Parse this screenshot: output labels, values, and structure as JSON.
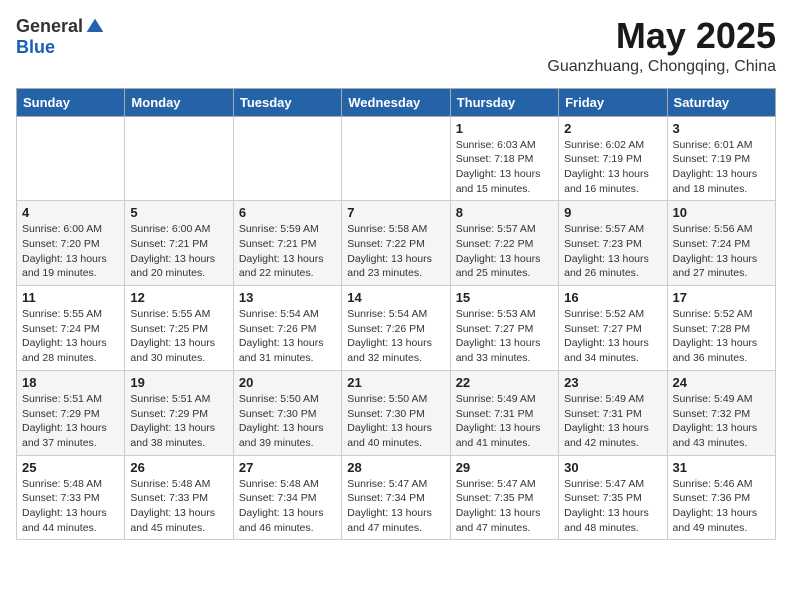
{
  "logo": {
    "general": "General",
    "blue": "Blue"
  },
  "title": "May 2025",
  "location": "Guanzhuang, Chongqing, China",
  "weekdays": [
    "Sunday",
    "Monday",
    "Tuesday",
    "Wednesday",
    "Thursday",
    "Friday",
    "Saturday"
  ],
  "rows": [
    [
      {
        "day": "",
        "info": ""
      },
      {
        "day": "",
        "info": ""
      },
      {
        "day": "",
        "info": ""
      },
      {
        "day": "",
        "info": ""
      },
      {
        "day": "1",
        "info": "Sunrise: 6:03 AM\nSunset: 7:18 PM\nDaylight: 13 hours\nand 15 minutes."
      },
      {
        "day": "2",
        "info": "Sunrise: 6:02 AM\nSunset: 7:19 PM\nDaylight: 13 hours\nand 16 minutes."
      },
      {
        "day": "3",
        "info": "Sunrise: 6:01 AM\nSunset: 7:19 PM\nDaylight: 13 hours\nand 18 minutes."
      }
    ],
    [
      {
        "day": "4",
        "info": "Sunrise: 6:00 AM\nSunset: 7:20 PM\nDaylight: 13 hours\nand 19 minutes."
      },
      {
        "day": "5",
        "info": "Sunrise: 6:00 AM\nSunset: 7:21 PM\nDaylight: 13 hours\nand 20 minutes."
      },
      {
        "day": "6",
        "info": "Sunrise: 5:59 AM\nSunset: 7:21 PM\nDaylight: 13 hours\nand 22 minutes."
      },
      {
        "day": "7",
        "info": "Sunrise: 5:58 AM\nSunset: 7:22 PM\nDaylight: 13 hours\nand 23 minutes."
      },
      {
        "day": "8",
        "info": "Sunrise: 5:57 AM\nSunset: 7:22 PM\nDaylight: 13 hours\nand 25 minutes."
      },
      {
        "day": "9",
        "info": "Sunrise: 5:57 AM\nSunset: 7:23 PM\nDaylight: 13 hours\nand 26 minutes."
      },
      {
        "day": "10",
        "info": "Sunrise: 5:56 AM\nSunset: 7:24 PM\nDaylight: 13 hours\nand 27 minutes."
      }
    ],
    [
      {
        "day": "11",
        "info": "Sunrise: 5:55 AM\nSunset: 7:24 PM\nDaylight: 13 hours\nand 28 minutes."
      },
      {
        "day": "12",
        "info": "Sunrise: 5:55 AM\nSunset: 7:25 PM\nDaylight: 13 hours\nand 30 minutes."
      },
      {
        "day": "13",
        "info": "Sunrise: 5:54 AM\nSunset: 7:26 PM\nDaylight: 13 hours\nand 31 minutes."
      },
      {
        "day": "14",
        "info": "Sunrise: 5:54 AM\nSunset: 7:26 PM\nDaylight: 13 hours\nand 32 minutes."
      },
      {
        "day": "15",
        "info": "Sunrise: 5:53 AM\nSunset: 7:27 PM\nDaylight: 13 hours\nand 33 minutes."
      },
      {
        "day": "16",
        "info": "Sunrise: 5:52 AM\nSunset: 7:27 PM\nDaylight: 13 hours\nand 34 minutes."
      },
      {
        "day": "17",
        "info": "Sunrise: 5:52 AM\nSunset: 7:28 PM\nDaylight: 13 hours\nand 36 minutes."
      }
    ],
    [
      {
        "day": "18",
        "info": "Sunrise: 5:51 AM\nSunset: 7:29 PM\nDaylight: 13 hours\nand 37 minutes."
      },
      {
        "day": "19",
        "info": "Sunrise: 5:51 AM\nSunset: 7:29 PM\nDaylight: 13 hours\nand 38 minutes."
      },
      {
        "day": "20",
        "info": "Sunrise: 5:50 AM\nSunset: 7:30 PM\nDaylight: 13 hours\nand 39 minutes."
      },
      {
        "day": "21",
        "info": "Sunrise: 5:50 AM\nSunset: 7:30 PM\nDaylight: 13 hours\nand 40 minutes."
      },
      {
        "day": "22",
        "info": "Sunrise: 5:49 AM\nSunset: 7:31 PM\nDaylight: 13 hours\nand 41 minutes."
      },
      {
        "day": "23",
        "info": "Sunrise: 5:49 AM\nSunset: 7:31 PM\nDaylight: 13 hours\nand 42 minutes."
      },
      {
        "day": "24",
        "info": "Sunrise: 5:49 AM\nSunset: 7:32 PM\nDaylight: 13 hours\nand 43 minutes."
      }
    ],
    [
      {
        "day": "25",
        "info": "Sunrise: 5:48 AM\nSunset: 7:33 PM\nDaylight: 13 hours\nand 44 minutes."
      },
      {
        "day": "26",
        "info": "Sunrise: 5:48 AM\nSunset: 7:33 PM\nDaylight: 13 hours\nand 45 minutes."
      },
      {
        "day": "27",
        "info": "Sunrise: 5:48 AM\nSunset: 7:34 PM\nDaylight: 13 hours\nand 46 minutes."
      },
      {
        "day": "28",
        "info": "Sunrise: 5:47 AM\nSunset: 7:34 PM\nDaylight: 13 hours\nand 47 minutes."
      },
      {
        "day": "29",
        "info": "Sunrise: 5:47 AM\nSunset: 7:35 PM\nDaylight: 13 hours\nand 47 minutes."
      },
      {
        "day": "30",
        "info": "Sunrise: 5:47 AM\nSunset: 7:35 PM\nDaylight: 13 hours\nand 48 minutes."
      },
      {
        "day": "31",
        "info": "Sunrise: 5:46 AM\nSunset: 7:36 PM\nDaylight: 13 hours\nand 49 minutes."
      }
    ]
  ]
}
